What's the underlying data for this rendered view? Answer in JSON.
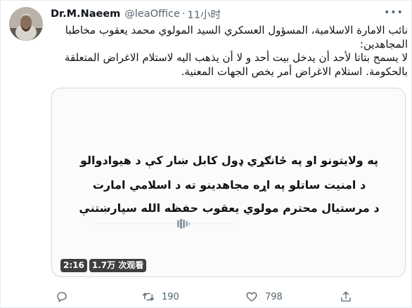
{
  "tweet": {
    "display_name": "Dr.M.Naeem",
    "handle": "@leaOffice",
    "separator": "·",
    "time": "11小时",
    "text_lines": [
      "نائب الامارة الاسلامية، المسؤول العسكري السيد المولوي محمد يعقوب مخاطبا",
      "المجاهدين:",
      "لا يسمح بتاتا لأحد أن يدخل بيت أحد و لا أن يذهب اليه لاستلام الاغراض المتعلقة",
      "بالحكومة. استلام الاغراض أمر يخص الجهات المعنية."
    ]
  },
  "media": {
    "lines": [
      "په ولايتونو او په ځانګړي ډول کابل ښار کې د هيوادوالو",
      "د امنيت ساتلو په اړه مجاهدينو ته د اسلامي امارت",
      "د مرستيال محترم مولوي يعقوب حفظه الله سپارښتنې"
    ],
    "duration": "2:16",
    "views": "1.7万 次观看"
  },
  "actions": {
    "reply_count": "",
    "retweet_count": "190",
    "like_count": "798"
  },
  "icons": {
    "more": "more-dots-icon",
    "reply": "reply-icon",
    "retweet": "retweet-icon",
    "like": "heart-icon",
    "share": "share-icon"
  },
  "colors": {
    "text": "#0f1419",
    "muted": "#536471",
    "border": "#cfd9de"
  }
}
